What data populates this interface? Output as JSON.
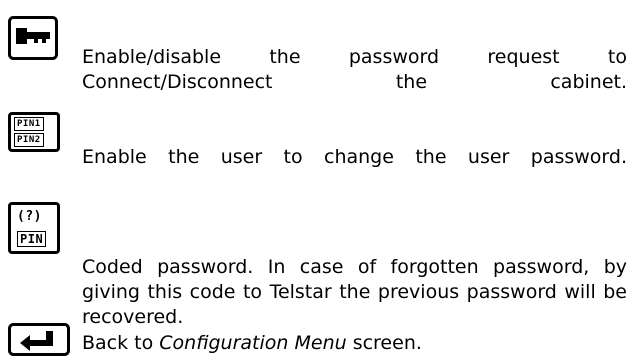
{
  "items": [
    {
      "icon": "key-icon",
      "text": "Enable/disable the password request to Connect/Disconnect the cabinet."
    },
    {
      "icon": "pin-change-icon",
      "icon_text": [
        "PIN1",
        "PIN2"
      ],
      "text": "Enable the user to change the user password."
    },
    {
      "icon": "pin-help-icon",
      "icon_text": [
        "(?)",
        "PIN"
      ],
      "text": "Coded password. In case of forgotten password, by giving this code to Telstar the previous password will be recovered."
    },
    {
      "icon": "back-arrow-icon",
      "text_before": "Back to ",
      "text_italic": "Configuration Menu",
      "text_after": " screen."
    }
  ]
}
